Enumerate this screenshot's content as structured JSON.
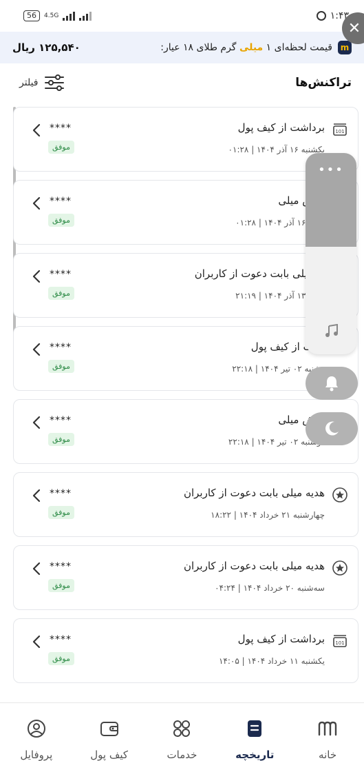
{
  "status_bar": {
    "battery": "56",
    "network": "4.5G",
    "time": "۱:۴۳"
  },
  "price_bar": {
    "label_prefix": "قیمت لحظه‌ای ۱",
    "brand": "میلی",
    "label_suffix": "گرم طلای ۱۸ عیار:",
    "value": "۱۲۵,۵۴۰ ریال",
    "logo_letter": "m"
  },
  "section": {
    "title": "تراکنش‌ها",
    "filter_label": "فیلتر"
  },
  "transactions": [
    {
      "title": "برداشت از کیف پول",
      "date": "یکشنبه ۱۶ آذر ۱۴۰۴ | ۰۱:۲۸",
      "amount": "****",
      "status": "موفق",
      "icon": "withdraw-icon"
    },
    {
      "title": "روش میلی",
      "date": "شنبه ۱۶ آذر ۱۴۰۴ | ۰۱:۲۸",
      "amount": "****",
      "status": "موفق",
      "icon": "none"
    },
    {
      "title": "یه میلی بابت دعوت از کاربران",
      "date": "شنبه ۱۳ آذر ۱۴۰۴ | ۲۱:۱۹",
      "amount": "****",
      "status": "موفق",
      "icon": "none"
    },
    {
      "title": "اشت از کیف پول",
      "date": "وشنبه ۰۲ تیر ۱۴۰۴ | ۲۲:۱۸",
      "amount": "****",
      "status": "موفق",
      "icon": "none"
    },
    {
      "title": "روش میلی",
      "date": "دوشنبه ۰۲ تیر ۱۴۰۴ | ۲۲:۱۸",
      "amount": "****",
      "status": "موفق",
      "icon": "none"
    },
    {
      "title": "هدیه میلی بابت دعوت از کاربران",
      "date": "چهارشنبه ۲۱ خرداد ۱۴۰۴ | ۱۸:۲۲",
      "amount": "****",
      "status": "موفق",
      "icon": "gift-star-icon"
    },
    {
      "title": "هدیه میلی بابت دعوت از کاربران",
      "date": "سه‌شنبه ۲۰ خرداد ۱۴۰۴ | ۰۴:۲۴",
      "amount": "****",
      "status": "موفق",
      "icon": "gift-star-icon"
    },
    {
      "title": "برداشت از کیف پول",
      "date": "یکشنبه ۱۱ خرداد ۱۴۰۴ | ۱۴:۰۵",
      "amount": "****",
      "status": "موفق",
      "icon": "withdraw-icon"
    }
  ],
  "side_panel": {
    "dots": "•••"
  },
  "bottom_nav": [
    {
      "label": "خانه",
      "icon": "home-logo-icon"
    },
    {
      "label": "تاریخچه",
      "icon": "history-icon",
      "active": true
    },
    {
      "label": "خدمات",
      "icon": "services-grid-icon"
    },
    {
      "label": "کیف پول",
      "icon": "wallet-icon"
    },
    {
      "label": "پروفایل",
      "icon": "profile-icon"
    }
  ],
  "colors": {
    "brand_navy": "#1b2a4e",
    "brand_gold": "#e8a400",
    "success_bg": "#e3f5e6",
    "success_text": "#2e8b47"
  }
}
